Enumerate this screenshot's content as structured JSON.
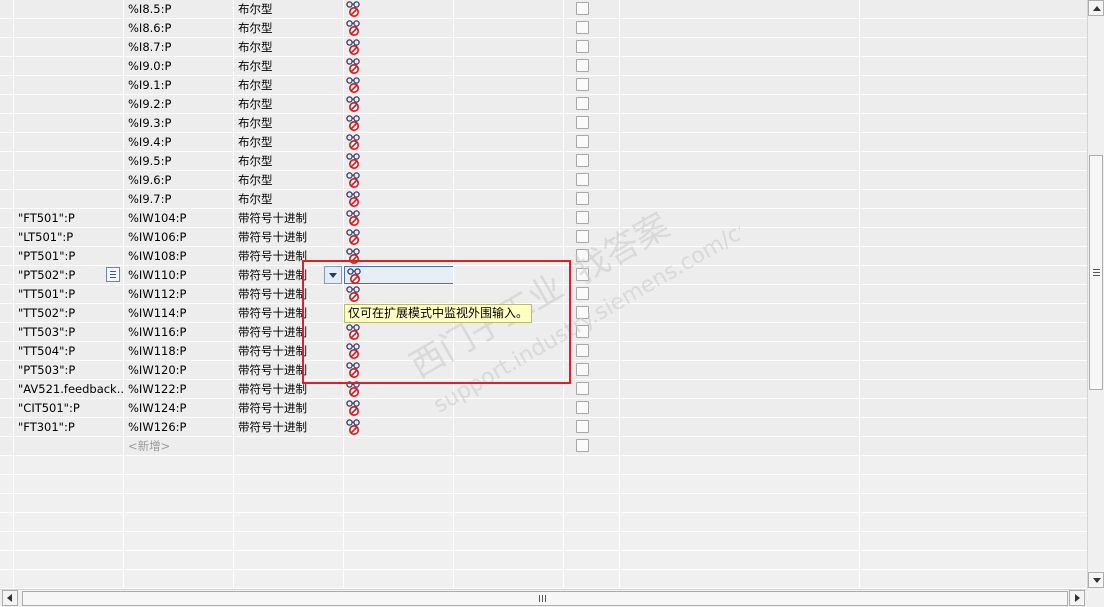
{
  "rows": [
    {
      "name": "",
      "address": "%I8.5:P",
      "format": "布尔型"
    },
    {
      "name": "",
      "address": "%I8.6:P",
      "format": "布尔型"
    },
    {
      "name": "",
      "address": "%I8.7:P",
      "format": "布尔型"
    },
    {
      "name": "",
      "address": "%I9.0:P",
      "format": "布尔型"
    },
    {
      "name": "",
      "address": "%I9.1:P",
      "format": "布尔型"
    },
    {
      "name": "",
      "address": "%I9.2:P",
      "format": "布尔型"
    },
    {
      "name": "",
      "address": "%I9.3:P",
      "format": "布尔型"
    },
    {
      "name": "",
      "address": "%I9.4:P",
      "format": "布尔型"
    },
    {
      "name": "",
      "address": "%I9.5:P",
      "format": "布尔型"
    },
    {
      "name": "",
      "address": "%I9.6:P",
      "format": "布尔型"
    },
    {
      "name": "",
      "address": "%I9.7:P",
      "format": "布尔型"
    },
    {
      "name": "\"FT501\":P",
      "address": "%IW104:P",
      "format": "带符号十进制"
    },
    {
      "name": "\"LT501\":P",
      "address": "%IW106:P",
      "format": "带符号十进制"
    },
    {
      "name": "\"PT501\":P",
      "address": "%IW108:P",
      "format": "带符号十进制"
    },
    {
      "name": "\"PT502\":P",
      "address": "%IW110:P",
      "format": "带符号十进制"
    },
    {
      "name": "\"TT501\":P",
      "address": "%IW112:P",
      "format": "带符号十进制"
    },
    {
      "name": "\"TT502\":P",
      "address": "%IW114:P",
      "format": "带符号十进制"
    },
    {
      "name": "\"TT503\":P",
      "address": "%IW116:P",
      "format": "带符号十进制"
    },
    {
      "name": "\"TT504\":P",
      "address": "%IW118:P",
      "format": "带符号十进制"
    },
    {
      "name": "\"PT503\":P",
      "address": "%IW120:P",
      "format": "带符号十进制"
    },
    {
      "name": "\"AV521.feedback...",
      "address": "%IW122:P",
      "format": "带符号十进制"
    },
    {
      "name": "\"CIT501\":P",
      "address": "%IW124:P",
      "format": "带符号十进制"
    },
    {
      "name": "\"FT301\":P",
      "address": "%IW126:P",
      "format": "带符号十进制"
    }
  ],
  "new_row_label": "<新增>",
  "tooltip": "仅可在扩展模式中监视外围输入。",
  "watermark": {
    "line1": "西门子工业",
    "line2": "找答案",
    "line3": "support.industry.siemens.com/cs"
  },
  "colors": {
    "highlight_box": "#e02020",
    "tooltip_bg": "#ffffc4"
  },
  "icons": {
    "monitor": "glasses-forbidden-icon",
    "dropdown": "dropdown-arrow-icon",
    "list": "list-icon"
  }
}
